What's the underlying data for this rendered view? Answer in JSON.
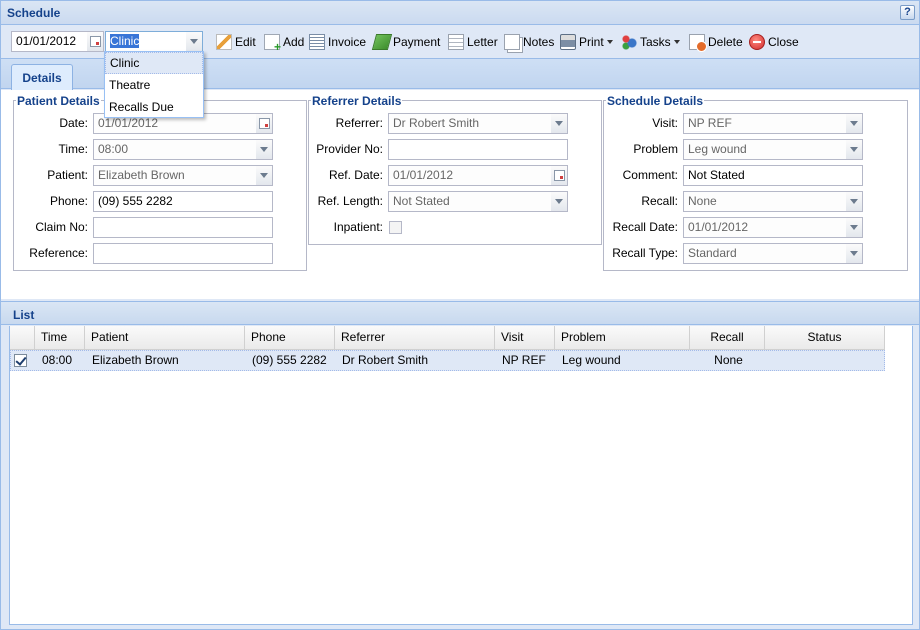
{
  "window": {
    "title": "Schedule",
    "help_label": "?"
  },
  "toolbar": {
    "date_value": "01/01/2012",
    "view_value": "Clinic",
    "buttons": {
      "edit": "Edit",
      "add": "Add",
      "invoice": "Invoice",
      "payment": "Payment",
      "letter": "Letter",
      "notes": "Notes",
      "print": "Print",
      "tasks": "Tasks",
      "delete": "Delete",
      "close": "Close"
    }
  },
  "view_dropdown": {
    "options": [
      "Clinic",
      "Theatre",
      "Recalls Due"
    ],
    "selected": "Clinic"
  },
  "tabs": [
    {
      "label": "Details",
      "active": true
    }
  ],
  "patient_details": {
    "legend": "Patient Details",
    "date": {
      "label": "Date:",
      "value": "01/01/2012"
    },
    "time": {
      "label": "Time:",
      "value": "08:00"
    },
    "patient": {
      "label": "Patient:",
      "value": "Elizabeth Brown"
    },
    "phone": {
      "label": "Phone:",
      "value": "(09) 555 2282"
    },
    "claim_no": {
      "label": "Claim No:",
      "value": ""
    },
    "reference": {
      "label": "Reference:",
      "value": ""
    }
  },
  "referrer_details": {
    "legend": "Referrer Details",
    "referrer": {
      "label": "Referrer:",
      "value": "Dr Robert Smith"
    },
    "provider_no": {
      "label": "Provider No:",
      "value": ""
    },
    "ref_date": {
      "label": "Ref. Date:",
      "value": "01/01/2012"
    },
    "ref_length": {
      "label": "Ref. Length:",
      "value": "Not Stated"
    },
    "inpatient": {
      "label": "Inpatient:",
      "checked": false
    }
  },
  "schedule_details": {
    "legend": "Schedule Details",
    "visit": {
      "label": "Visit:",
      "value": "NP REF"
    },
    "problem": {
      "label": "Problem",
      "value": "Leg wound"
    },
    "comment": {
      "label": "Comment:",
      "value": "Not Stated"
    },
    "recall": {
      "label": "Recall:",
      "value": "None"
    },
    "recall_date": {
      "label": "Recall Date:",
      "value": "01/01/2012"
    },
    "recall_type": {
      "label": "Recall Type:",
      "value": "Standard"
    }
  },
  "list": {
    "title": "List",
    "columns": [
      "Time",
      "Patient",
      "Phone",
      "Referrer",
      "Visit",
      "Problem",
      "Recall",
      "Status"
    ],
    "rows": [
      {
        "checked": true,
        "time": "08:00",
        "patient": "Elizabeth Brown",
        "phone": "(09) 555 2282",
        "referrer": "Dr Robert Smith",
        "visit": "NP REF",
        "problem": "Leg wound",
        "recall": "None",
        "status": ""
      }
    ]
  }
}
